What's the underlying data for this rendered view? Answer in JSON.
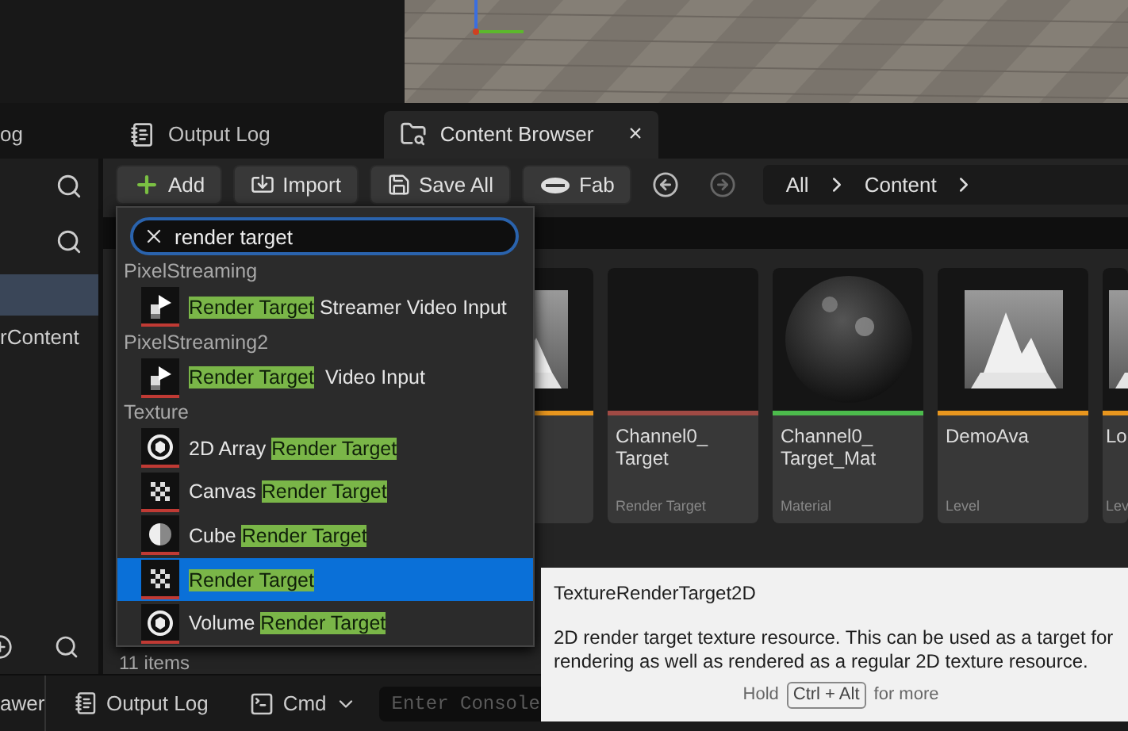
{
  "side_tab": {
    "label": "og"
  },
  "tabs": [
    {
      "label": "Output Log",
      "kind": "log",
      "selected": false
    },
    {
      "label": "Content Browser",
      "kind": "folder",
      "selected": true
    }
  ],
  "close_glyph": "×",
  "left_panel": {
    "item": "rContent"
  },
  "toolbar": {
    "buttons": [
      {
        "label": "Add",
        "kind": "plus"
      },
      {
        "label": "Import",
        "kind": "import"
      },
      {
        "label": "Save All",
        "kind": "save"
      },
      {
        "label": "Fab",
        "kind": "fab"
      }
    ],
    "path": [
      "All",
      "Content"
    ]
  },
  "assets": [
    {
      "kind": "level",
      "color": "#e8961e"
    },
    {
      "name": "Channel0_ Target",
      "type": "Render Target",
      "kind": "black",
      "color": "#a04a44"
    },
    {
      "name": "Channel0_ Target_Mat",
      "type": "Material",
      "kind": "sphere",
      "color": "#4cbb4c"
    },
    {
      "name": "DemoAva",
      "type": "Level",
      "kind": "level",
      "color": "#e8961e"
    },
    {
      "name": "Lo",
      "type": "Lev",
      "kind": "level",
      "color": "#e8961e"
    }
  ],
  "item_count": "11 items",
  "menu": {
    "search": "render target",
    "groups": [
      {
        "title": "PixelStreaming",
        "items": [
          {
            "kind": "play",
            "selected": false,
            "parts": [
              {
                "text": "Render Target",
                "match": true
              },
              {
                "text": " Streamer Video Input",
                "match": false
              }
            ]
          }
        ]
      },
      {
        "title": "PixelStreaming2",
        "items": [
          {
            "kind": "play",
            "selected": false,
            "parts": [
              {
                "text": "Render Target",
                "match": true
              },
              {
                "text": "  Video Input",
                "match": false
              }
            ]
          }
        ]
      },
      {
        "title": "Texture",
        "items": [
          {
            "kind": "sphere",
            "selected": false,
            "parts": [
              {
                "text": "2D Array ",
                "match": false
              },
              {
                "text": "Render Target",
                "match": true
              }
            ]
          },
          {
            "kind": "checker",
            "selected": false,
            "parts": [
              {
                "text": "Canvas ",
                "match": false
              },
              {
                "text": "Render Target",
                "match": true
              }
            ]
          },
          {
            "kind": "cube",
            "selected": false,
            "parts": [
              {
                "text": "Cube ",
                "match": false
              },
              {
                "text": "Render Target",
                "match": true
              }
            ]
          },
          {
            "kind": "checker",
            "selected": true,
            "parts": [
              {
                "text": "Render Target",
                "match": true
              }
            ]
          },
          {
            "kind": "sphere",
            "selected": false,
            "parts": [
              {
                "text": "Volume ",
                "match": false
              },
              {
                "text": "Render Target",
                "match": true
              }
            ]
          }
        ]
      }
    ]
  },
  "tooltip": {
    "title": "TextureRenderTarget2D",
    "body": "2D render target texture resource. This can be used as a target for rendering as well as rendered as a regular 2D texture resource.",
    "hint_before": "Hold",
    "key": "Ctrl + Alt",
    "hint_after": "for more"
  },
  "status_bar": {
    "drawer": "awer",
    "output_log": "Output Log",
    "cmd": "Cmd",
    "console_placeholder": "Enter Console"
  }
}
